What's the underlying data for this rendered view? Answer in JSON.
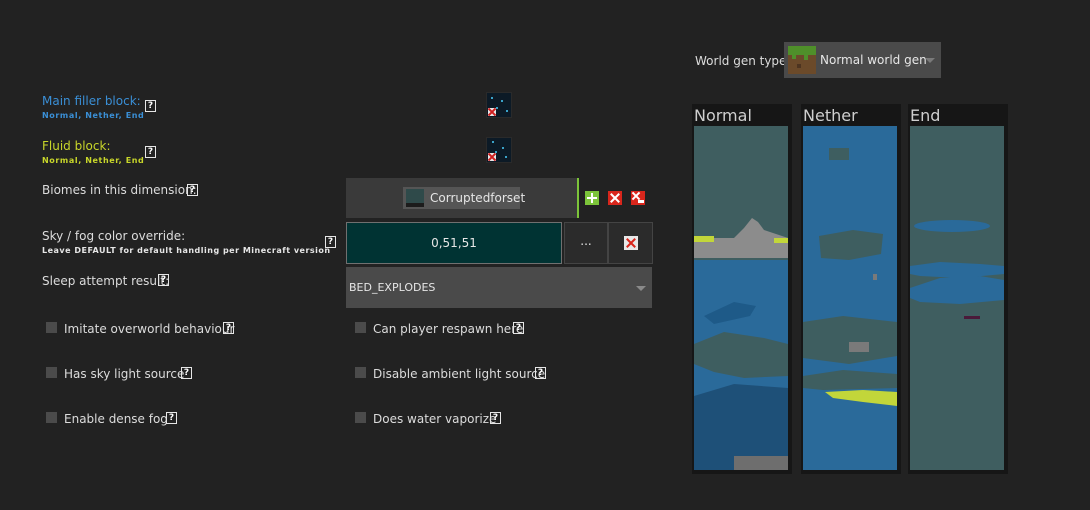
{
  "main_filler": {
    "label": "Main filler block:",
    "sub": "Normal, Nether, End",
    "help": "?"
  },
  "fluid_block": {
    "label": "Fluid block:",
    "sub": "Normal, Nether, End",
    "help": "?"
  },
  "biomes": {
    "label": "Biomes in this dimension:",
    "help": "?",
    "items": [
      "Corruptedforset"
    ]
  },
  "sky_fog": {
    "label": "Sky / fog color override:",
    "sub": "Leave DEFAULT for default handling per Minecraft version",
    "help": "?",
    "value": "0,51,51",
    "more_label": "...",
    "swatch_color": "#003333"
  },
  "sleep": {
    "label": "Sleep attempt result:",
    "help": "?",
    "value": "BED_EXPLODES"
  },
  "checkboxes": {
    "imitate_overworld": "Imitate overworld behaviour",
    "player_respawn": "Can player respawn here",
    "sky_light": "Has sky light source",
    "disable_ambient": "Disable ambient light source",
    "dense_fog": "Enable dense fog",
    "water_vaporize": "Does water vaporize",
    "help": "?"
  },
  "world_gen": {
    "label": "World gen type:",
    "value": "Normal world gen"
  },
  "previews": {
    "normal": "Normal",
    "nether": "Nether",
    "end": "End"
  },
  "colors": {
    "accent_blue": "#3a8fd6",
    "accent_yellow": "#c8d62a",
    "add_green": "#7cc43a",
    "remove_red": "#d9261c"
  }
}
